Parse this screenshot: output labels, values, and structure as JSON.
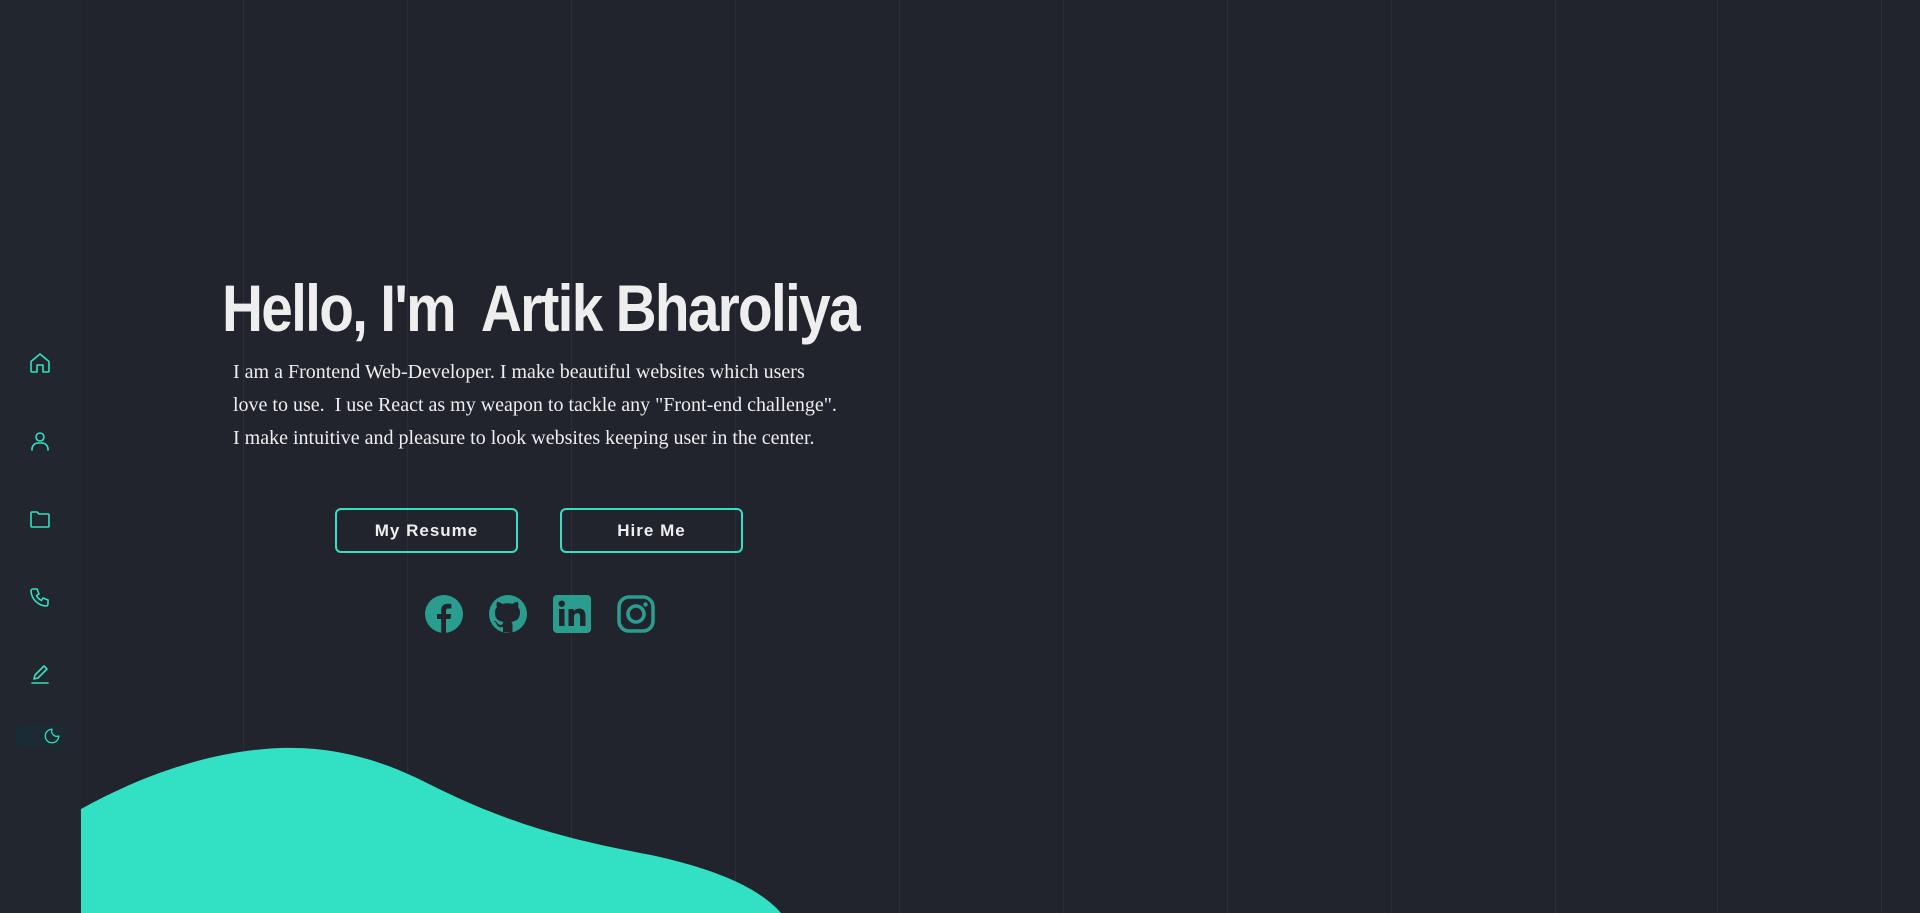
{
  "colors": {
    "background": "#21242c",
    "sidebar": "#22262e",
    "accent": "#32e0c4",
    "social": "#2a9d8f",
    "text": "#eeeeee"
  },
  "sidebar": {
    "items": [
      {
        "icon": "home-icon",
        "label": "Home"
      },
      {
        "icon": "user-icon",
        "label": "About"
      },
      {
        "icon": "folder-icon",
        "label": "Projects"
      },
      {
        "icon": "phone-icon",
        "label": "Contact"
      },
      {
        "icon": "pen-icon",
        "label": "Blog"
      }
    ],
    "theme_toggle": {
      "icon": "moon-icon",
      "mode": "dark"
    }
  },
  "hero": {
    "title": "Hello, I'm  Artik Bharoliya",
    "description_lines": [
      "I am a Frontend Web-Developer. I make beautiful websites which users",
      "love to use.  I use React as my weapon to tackle any \"Front-end challenge\".",
      "I make intuitive and pleasure to look websites keeping user in the center."
    ]
  },
  "buttons": {
    "resume_label": "My Resume",
    "hire_label": "Hire Me"
  },
  "socials": [
    {
      "icon": "facebook-icon"
    },
    {
      "icon": "github-icon"
    },
    {
      "icon": "linkedin-icon"
    },
    {
      "icon": "instagram-icon"
    }
  ]
}
